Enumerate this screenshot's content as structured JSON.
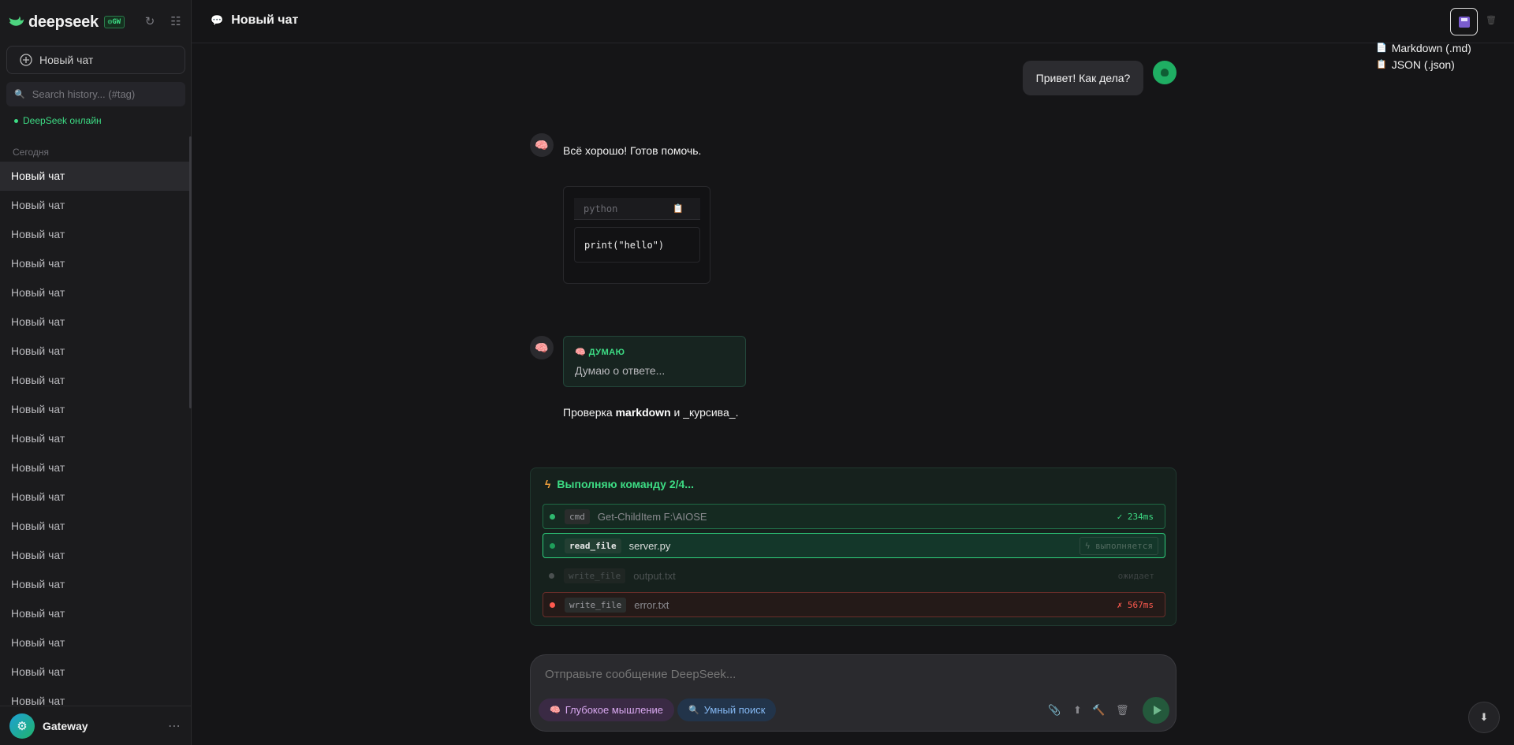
{
  "sidebar": {
    "logo_text": "deepseek",
    "gw_badge": "GW",
    "refresh_icon": "refresh-icon",
    "layout_icon": "grid-icon",
    "new_chat_label": "Новый чат",
    "search_placeholder": "Search history... (#tag)",
    "status_text": "DeepSeek онлайн",
    "section_today": "Сегодня",
    "chats": [
      "Новый чат",
      "Новый чат",
      "Новый чат",
      "Новый чат",
      "Новый чат",
      "Новый чат",
      "Новый чат",
      "Новый чат",
      "Новый чат",
      "Новый чат",
      "Новый чат",
      "Новый чат",
      "Новый чат",
      "Новый чат",
      "Новый чат",
      "Новый чат",
      "Новый чат",
      "Новый чат",
      "Новый чат"
    ],
    "user_name": "Gateway",
    "user_avatar_icon": "gear-icon",
    "more_icon": "ellipsis-icon"
  },
  "header": {
    "title": "Новый чат",
    "title_icon": "speech-bubble-icon",
    "export_icon": "floppy-disk-icon",
    "delete_icon": "trash-icon",
    "export_menu": [
      {
        "icon": "📄",
        "label": "Markdown (.md)"
      },
      {
        "icon": "📋",
        "label": "JSON (.json)"
      }
    ]
  },
  "messages": {
    "user_text": "Привет! Как дела?",
    "bot1_text": "Всё хорошо! Готов помочь.",
    "code_lang": "python",
    "code_copy_icon": "📋",
    "code_text": "print(\"hello\")",
    "think_label": "ДУМАЮ",
    "think_icon": "🧠",
    "think_text": "Думаю о ответе...",
    "md_prefix": "Проверка ",
    "md_bold": "markdown",
    "md_suffix": " и _курсива_."
  },
  "commands": {
    "title": "Выполняю команду 2/4...",
    "rows": [
      {
        "tag": "cmd",
        "arg": "Get-ChildItem F:\\AIOSE",
        "status": "✓ 234ms"
      },
      {
        "tag": "read_file",
        "arg": "server.py",
        "status": "выполняется"
      },
      {
        "tag": "write_file",
        "arg": "output.txt",
        "status": "ожидает"
      },
      {
        "tag": "write_file",
        "arg": "error.txt",
        "status": "✗ 567ms"
      }
    ]
  },
  "composer": {
    "placeholder": "Отправьте сообщение DeepSeek...",
    "deep_label": "Глубокое мышление",
    "search_label": "Умный поиск"
  },
  "colors": {
    "accent": "#3ddc84",
    "error": "#ff5a4f",
    "background": "#151517",
    "sidebar": "#1b1b1d"
  }
}
